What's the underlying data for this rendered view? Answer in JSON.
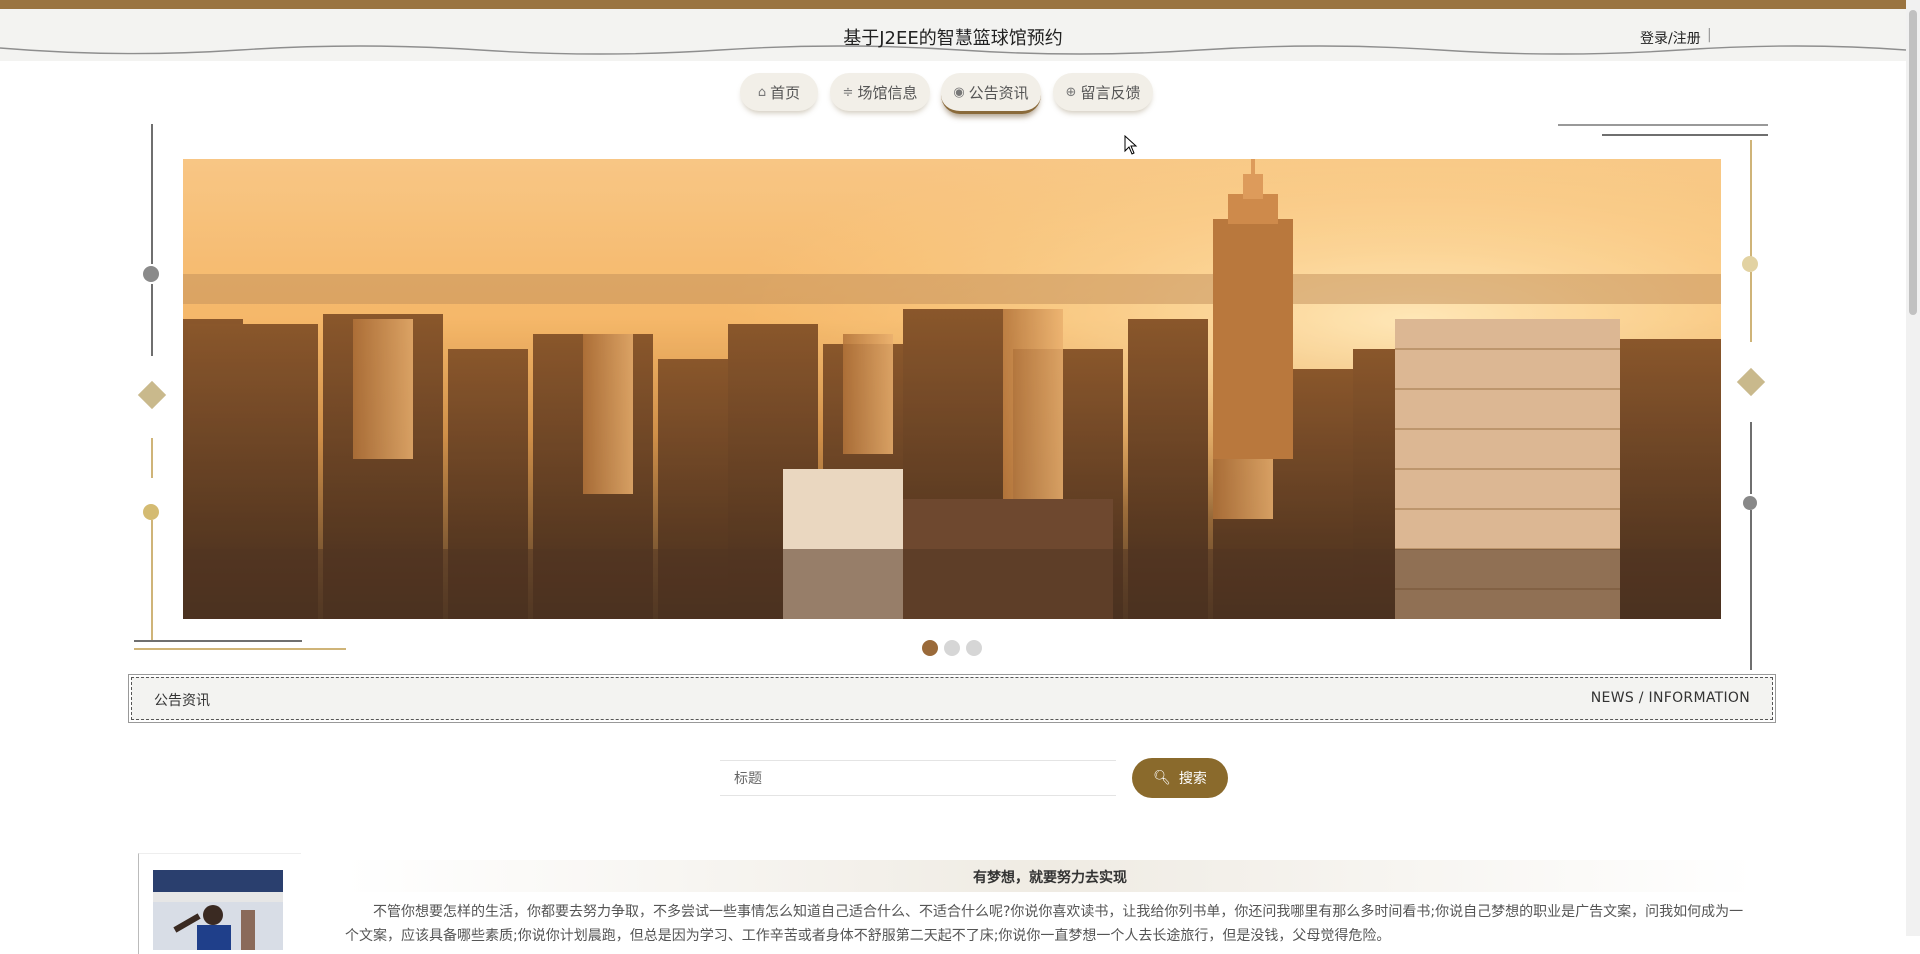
{
  "header": {
    "title": "基于J2EE的智慧篮球馆预约",
    "login_label": "登录/注册",
    "separator": "|"
  },
  "nav": {
    "items": [
      {
        "label": "首页",
        "icon": "home-icon"
      },
      {
        "label": "场馆信息",
        "icon": "sliders-icon"
      },
      {
        "label": "公告资讯",
        "icon": "palette-icon"
      },
      {
        "label": "留言反馈",
        "icon": "globe-icon"
      }
    ],
    "active_index": 2
  },
  "banner": {
    "slide_count": 3,
    "active_slide": 1
  },
  "section": {
    "title": "公告资讯",
    "subtitle": "NEWS / INFORMATION"
  },
  "search": {
    "placeholder": "标题",
    "button_label": "搜索",
    "icon": "search-icon"
  },
  "news": [
    {
      "title": "有梦想，就要努力去实现",
      "excerpt": "不管你想要怎样的生活，你都要去努力争取，不多尝试一些事情怎么知道自己适合什么、不适合什么呢?你说你喜欢读书，让我给你列书单，你还问我哪里有那么多时间看书;你说自己梦想的职业是广告文案，问我如何成为一个文案，应该具备哪些素质;你说你计划晨跑，但总是因为学习、工作辛苦或者身体不舒服第二天起不了床;你说你一直梦想一个人去长途旅行，但是没钱，父母觉得危险。"
    }
  ],
  "colors": {
    "accent": "#9a7440",
    "button": "#8a6a2c",
    "header_bg": "#f3f3f1"
  }
}
